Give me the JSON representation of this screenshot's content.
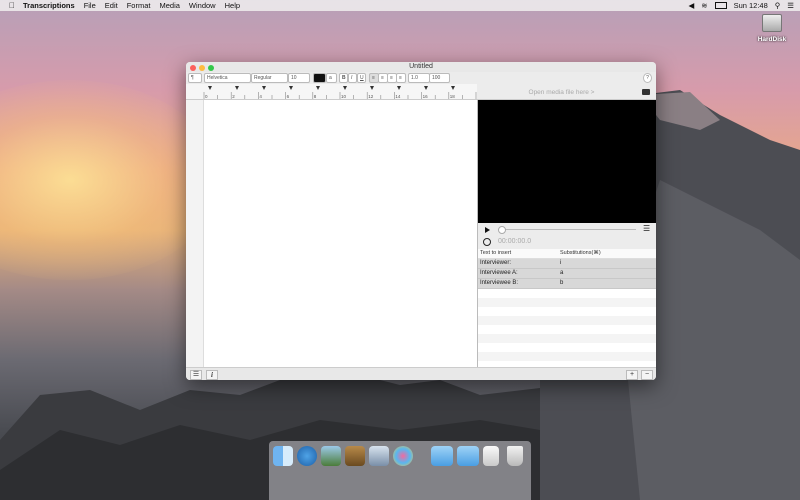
{
  "menubar": {
    "app_name": "Transcriptions",
    "menus": [
      "File",
      "Edit",
      "Format",
      "Media",
      "Window",
      "Help"
    ],
    "clock": "Sun 12:48"
  },
  "desktop": {
    "disk_label": "HardDisk"
  },
  "window": {
    "title": "Untitled",
    "toolbar": {
      "font_family": "Helvetica",
      "font_style": "Regular",
      "font_size": "10",
      "bold": "B",
      "italic": "I",
      "underline": "U",
      "line_spacing": "1.0",
      "zoom": "100"
    },
    "ruler": {
      "ticks": [
        "0",
        "2",
        "4",
        "6",
        "8",
        "10",
        "12",
        "14",
        "16",
        "18"
      ]
    },
    "media": {
      "placeholder": "Open media file here >",
      "timecode": "00:00:00.0"
    },
    "substitutions": {
      "header_text": "Text to insert",
      "header_sub": "Substitutions(⌘)",
      "rows": [
        {
          "text": "Interviewer:",
          "key": "i"
        },
        {
          "text": "Interviewee A:",
          "key": "a"
        },
        {
          "text": "Interviewee B:",
          "key": "b"
        }
      ]
    },
    "bottom": {
      "info": "i",
      "add": "+",
      "remove": "−"
    }
  },
  "colors": {
    "close": "#fc605c",
    "minimize": "#fdbc40",
    "zoom": "#34c84a",
    "video_bg": "#000000"
  }
}
